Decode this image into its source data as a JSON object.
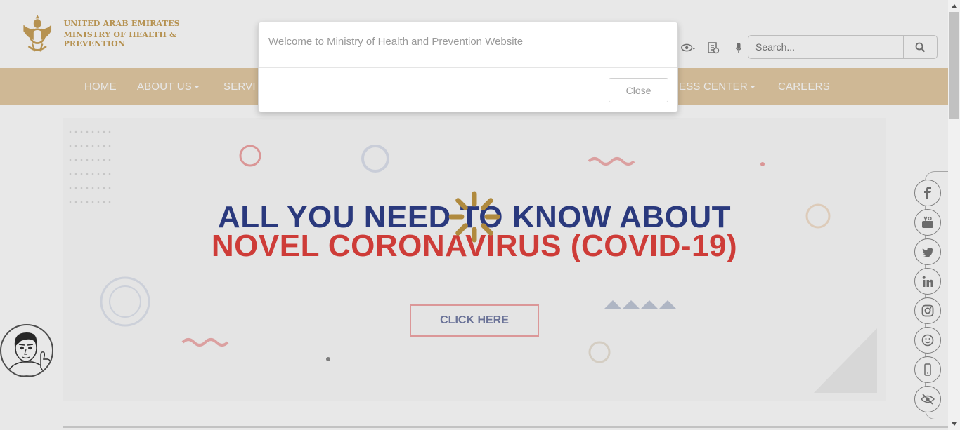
{
  "header": {
    "logo_line1": "UNITED ARAB EMIRATES",
    "logo_line2": "MINISTRY OF HEALTH & PREVENTION",
    "tools": [
      "eye-visibility-icon",
      "translate-doc-icon",
      "microphone-icon"
    ],
    "search": {
      "placeholder": "Search..."
    }
  },
  "nav": {
    "items": [
      {
        "label": "HOME",
        "dropdown": false
      },
      {
        "label": "ABOUT US",
        "dropdown": true
      },
      {
        "label": "SERVI",
        "dropdown": false
      },
      {
        "label": "ESS CENTER",
        "dropdown": true
      },
      {
        "label": "CAREERS",
        "dropdown": false
      }
    ]
  },
  "hero": {
    "line1": "ALL YOU NEED TO KNOW ABOUT",
    "line2": "NOVEL CORONAVIRUS (COVID-19)",
    "button": "CLICK HERE"
  },
  "social": [
    "facebook-icon",
    "youtube-icon",
    "twitter-icon",
    "linkedin-icon",
    "instagram-icon",
    "smiley-icon",
    "mobile-icon",
    "visibility-off-icon"
  ],
  "modal": {
    "message": "Welcome to Ministry of Health and Prevention Website",
    "close_label": "Close"
  },
  "colors": {
    "nav_bg": "#e4cba4",
    "gold": "#c9a15a",
    "hero_blue": "#2f3f8a",
    "hero_red": "#e3423e"
  }
}
